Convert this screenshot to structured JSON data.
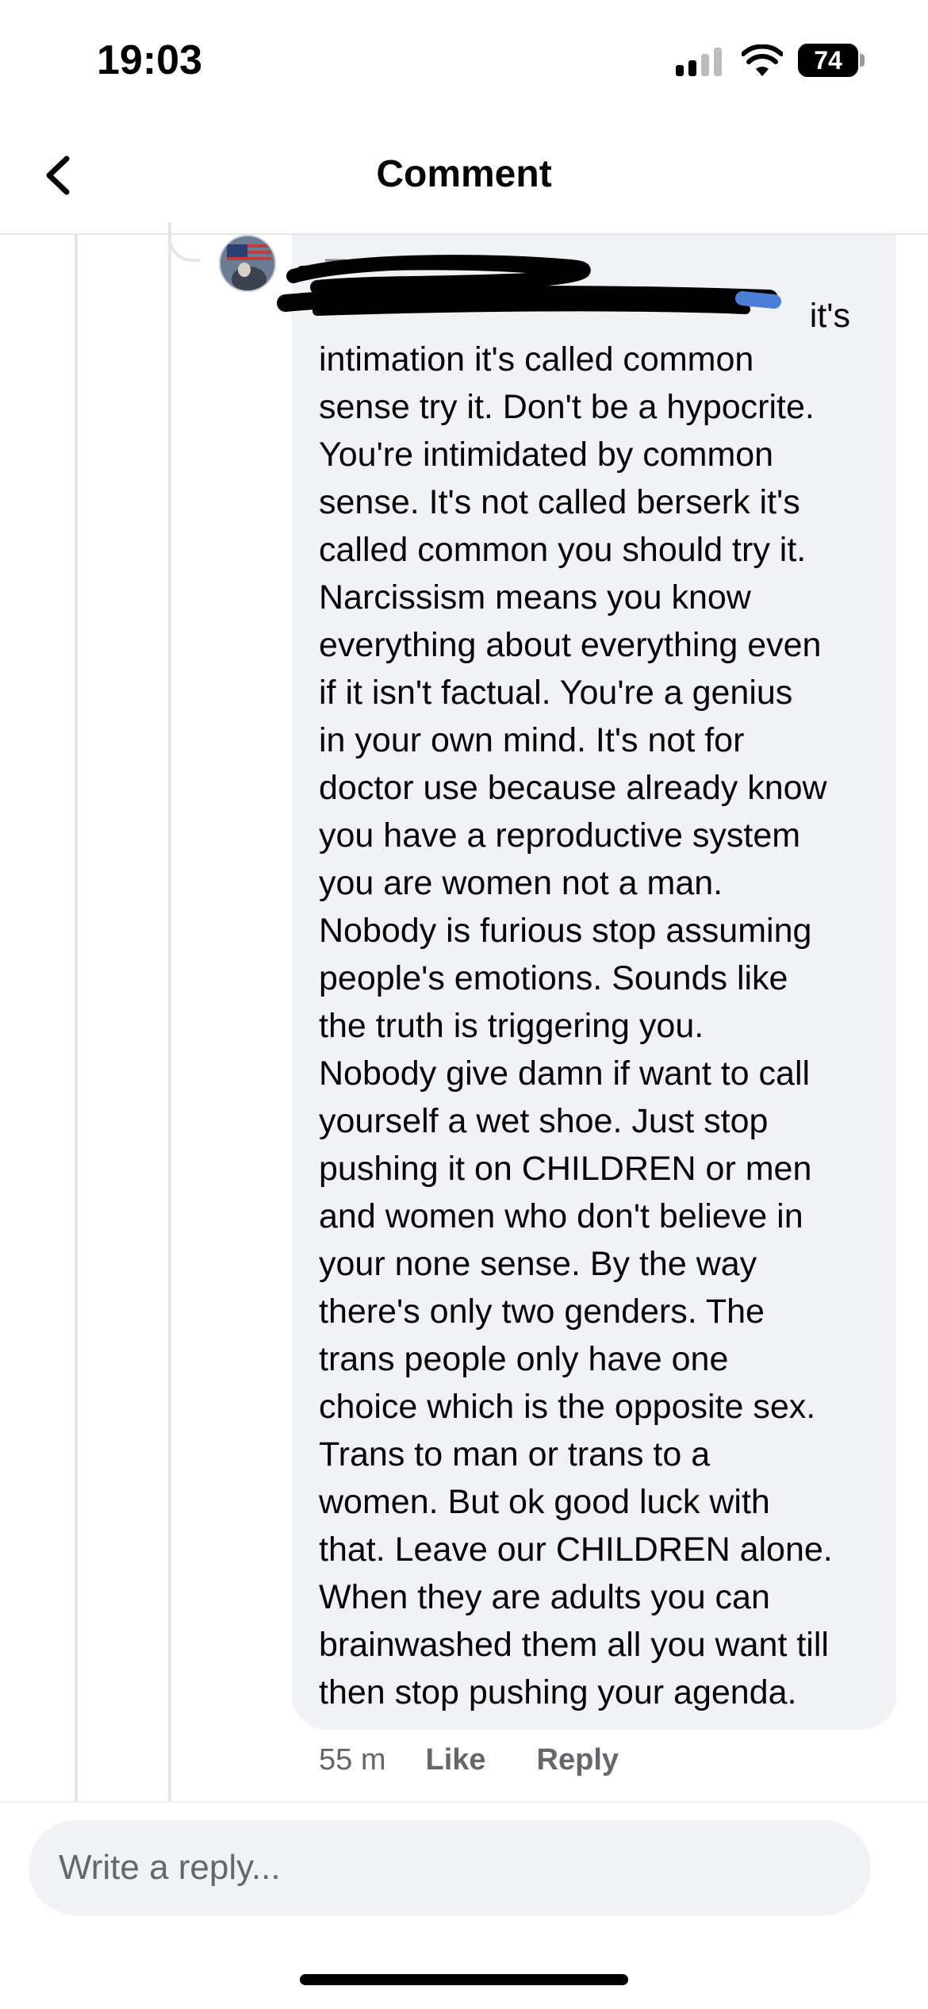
{
  "status_bar": {
    "time": "19:03",
    "battery": "74",
    "signal_icon": "cellular-signal-icon",
    "wifi_icon": "wifi-icon",
    "battery_icon": "battery-icon"
  },
  "header": {
    "title": "Comment",
    "back_icon": "chevron-left-icon"
  },
  "comment": {
    "first_line_end": "it's",
    "body": "intimation it's called common\nsense try it. Don't be a hypocrite.\nYou're intimidated by common\nsense. It's not called berserk it's\ncalled common you should try it.\nNarcissism means you know\neverything about everything even\nif it isn't factual. You're a genius\nin your own mind. It's not for\ndoctor use because already know\nyou have a reproductive system\nyou are women not a man.\nNobody is furious stop assuming\npeople's emotions. Sounds like\nthe truth is triggering you.\nNobody give damn if want to call\nyourself a wet shoe. Just stop\npushing it on CHILDREN or men\nand women who don't believe in\nyour none sense. By the way\nthere's only two genders. The\ntrans people only have one\nchoice which is the opposite sex.\nTrans to man or trans to a\nwomen.  But ok good luck with\nthat. Leave our CHILDREN alone.\nWhen they are adults you can\nbrainwashed them all you want till\nthen stop pushing your agenda.",
    "time_ago": "55 m",
    "like_label": "Like",
    "reply_label": "Reply"
  },
  "composer": {
    "placeholder": "Write a reply..."
  },
  "colors": {
    "bubble": "#f0f2f5",
    "meta_text": "#65676b",
    "thread_line": "#e4e6eb",
    "link_blue": "#216fdb"
  }
}
